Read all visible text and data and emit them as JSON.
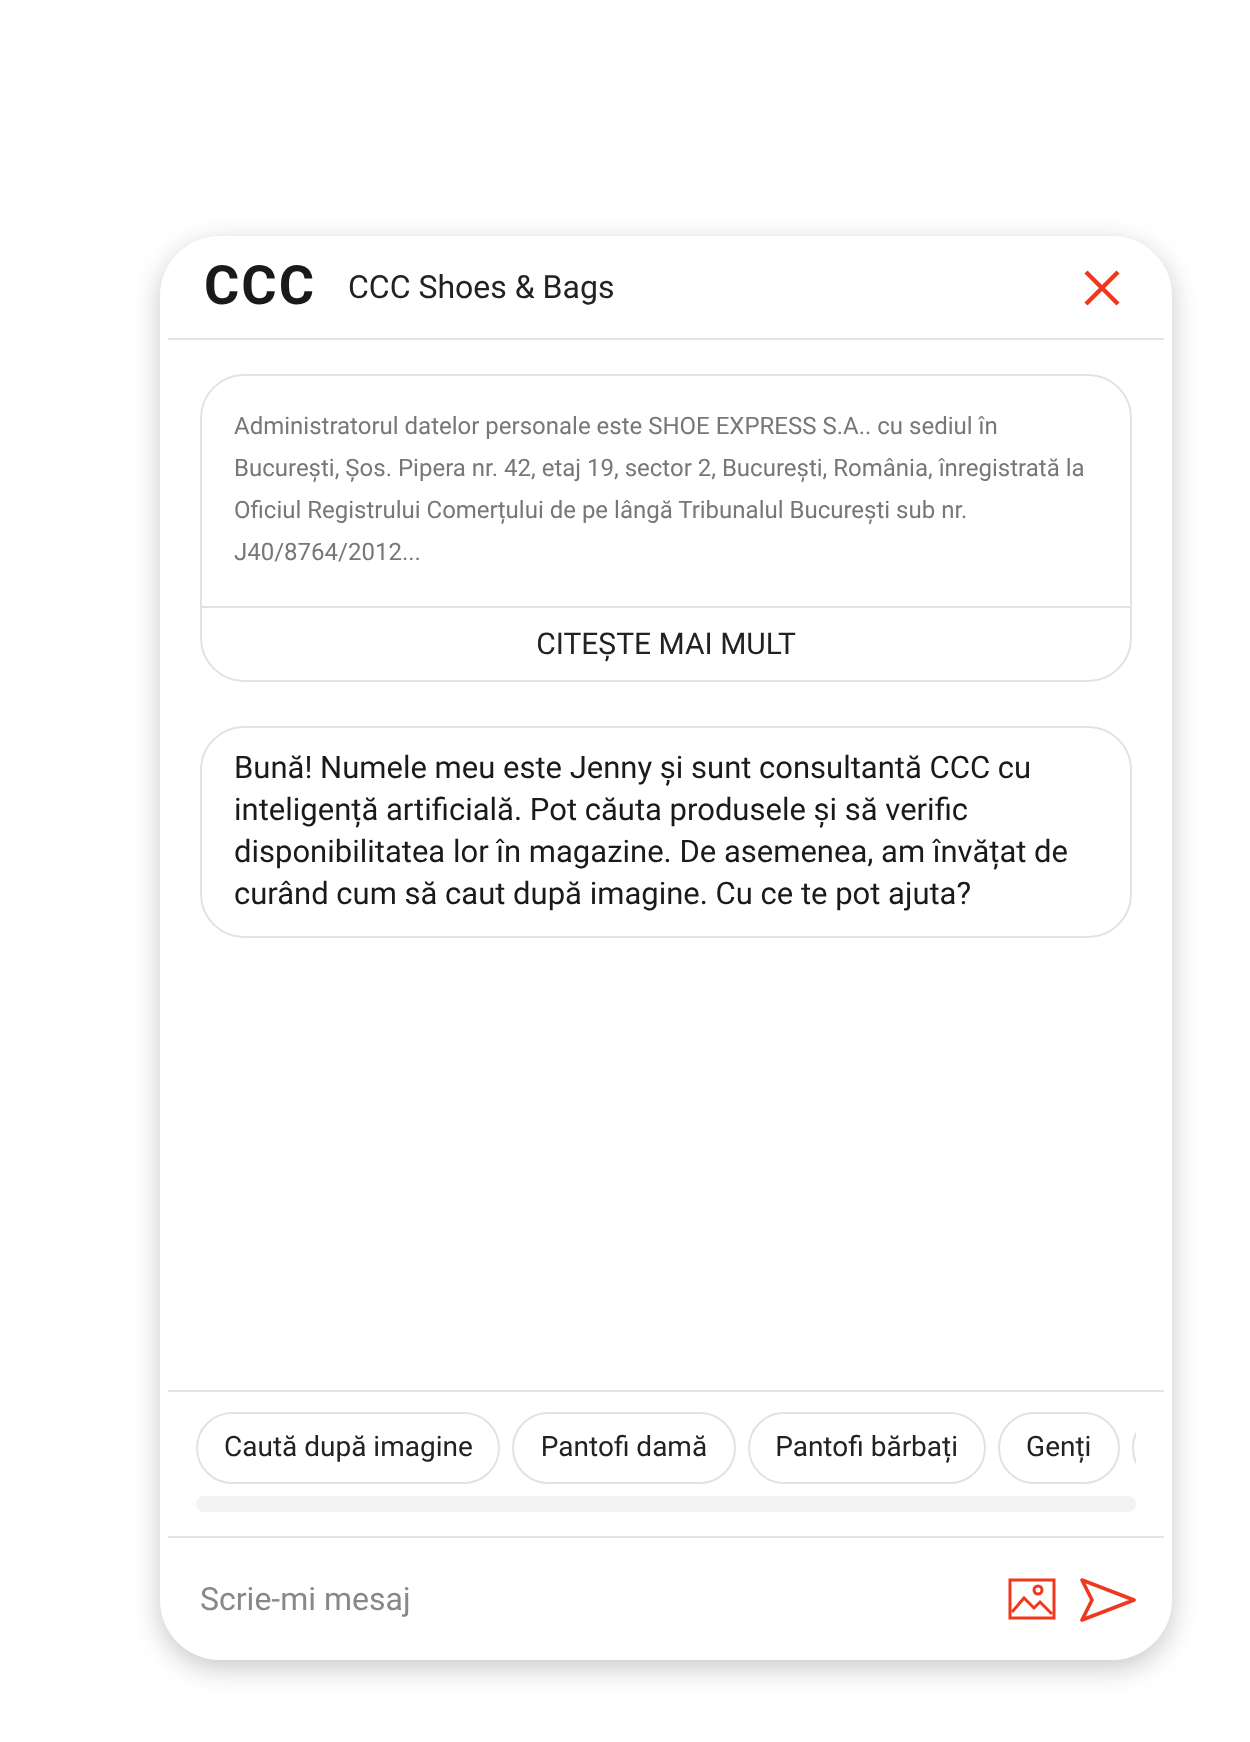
{
  "header": {
    "logo": "CCC",
    "title": "CCC Shoes & Bags"
  },
  "privacy": {
    "text": "Administratorul datelor personale este SHOE EXPRESS S.A.. cu sediul în București, Șos. Pipera nr. 42, etaj 19, sector 2, București, România, înregistrată la Oficiul Registrului Comerțului de pe lângă Tribunalul București sub nr. J40/8764/2012...",
    "action": "CITEȘTE MAI MULT"
  },
  "messages": [
    "Bună! Numele meu este Jenny și sunt consultantă CCC cu inteligență artificială. Pot căuta produsele și să verific disponibilitatea lor în magazine. De asemenea, am învățat de curând cum să caut după imagine. Cu ce te pot ajuta?"
  ],
  "suggestions": [
    "Caută după imagine",
    "Pantofi damă",
    "Pantofi bărbați",
    "Genți"
  ],
  "composer": {
    "placeholder": "Scrie-mi mesaj"
  }
}
